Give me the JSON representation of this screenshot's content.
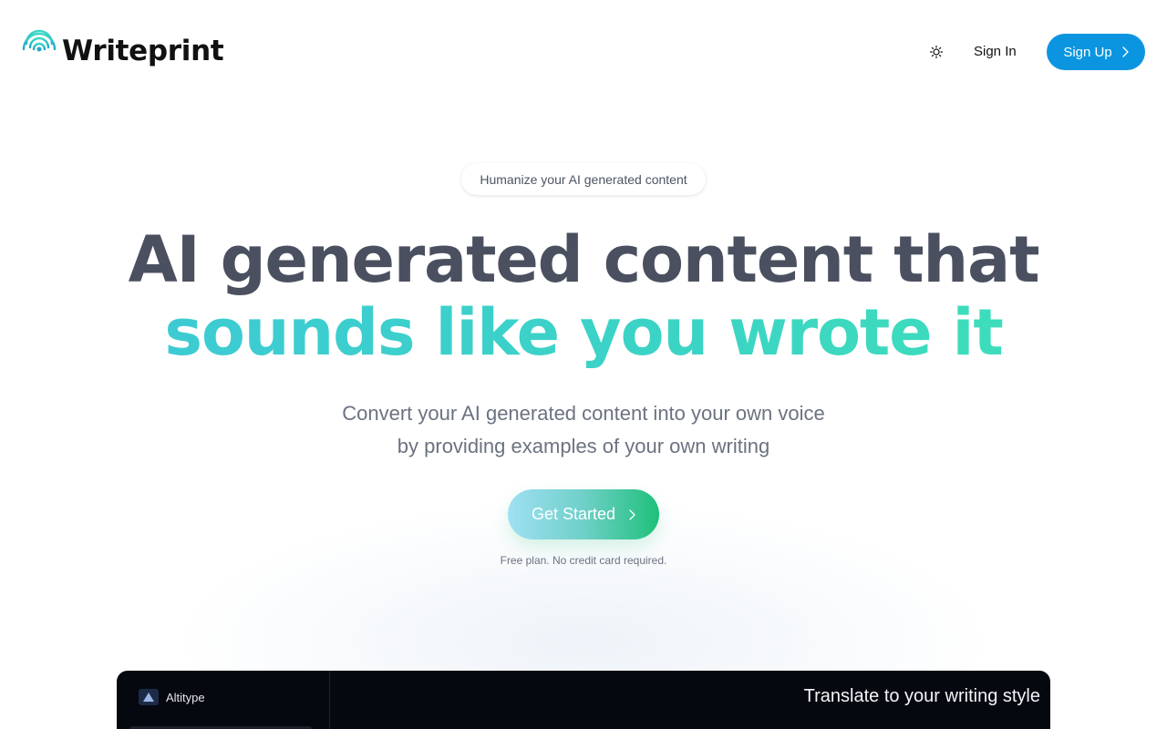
{
  "brand": {
    "name": "Writeprint",
    "accent": "#0b95e0",
    "gradient": [
      "#3ec8d8",
      "#3ee2b6"
    ]
  },
  "nav": {
    "theme_icon": "sun-icon",
    "signin_label": "Sign In",
    "signup_label": "Sign Up",
    "signup_icon": "chevron-right-icon"
  },
  "hero": {
    "badge": "Humanize your AI generated content",
    "headline_line1": "AI generated content that",
    "headline_line2": "sounds like you wrote it",
    "subtitle_line1": "Convert your AI generated content into your own voice",
    "subtitle_line2": "by providing examples of your own writing",
    "cta_label": "Get Started",
    "cta_icon": "chevron-right-icon",
    "cta_note": "Free plan. No credit card required."
  },
  "preview": {
    "app_name": "Altitype",
    "title": "Translate to your writing style"
  }
}
